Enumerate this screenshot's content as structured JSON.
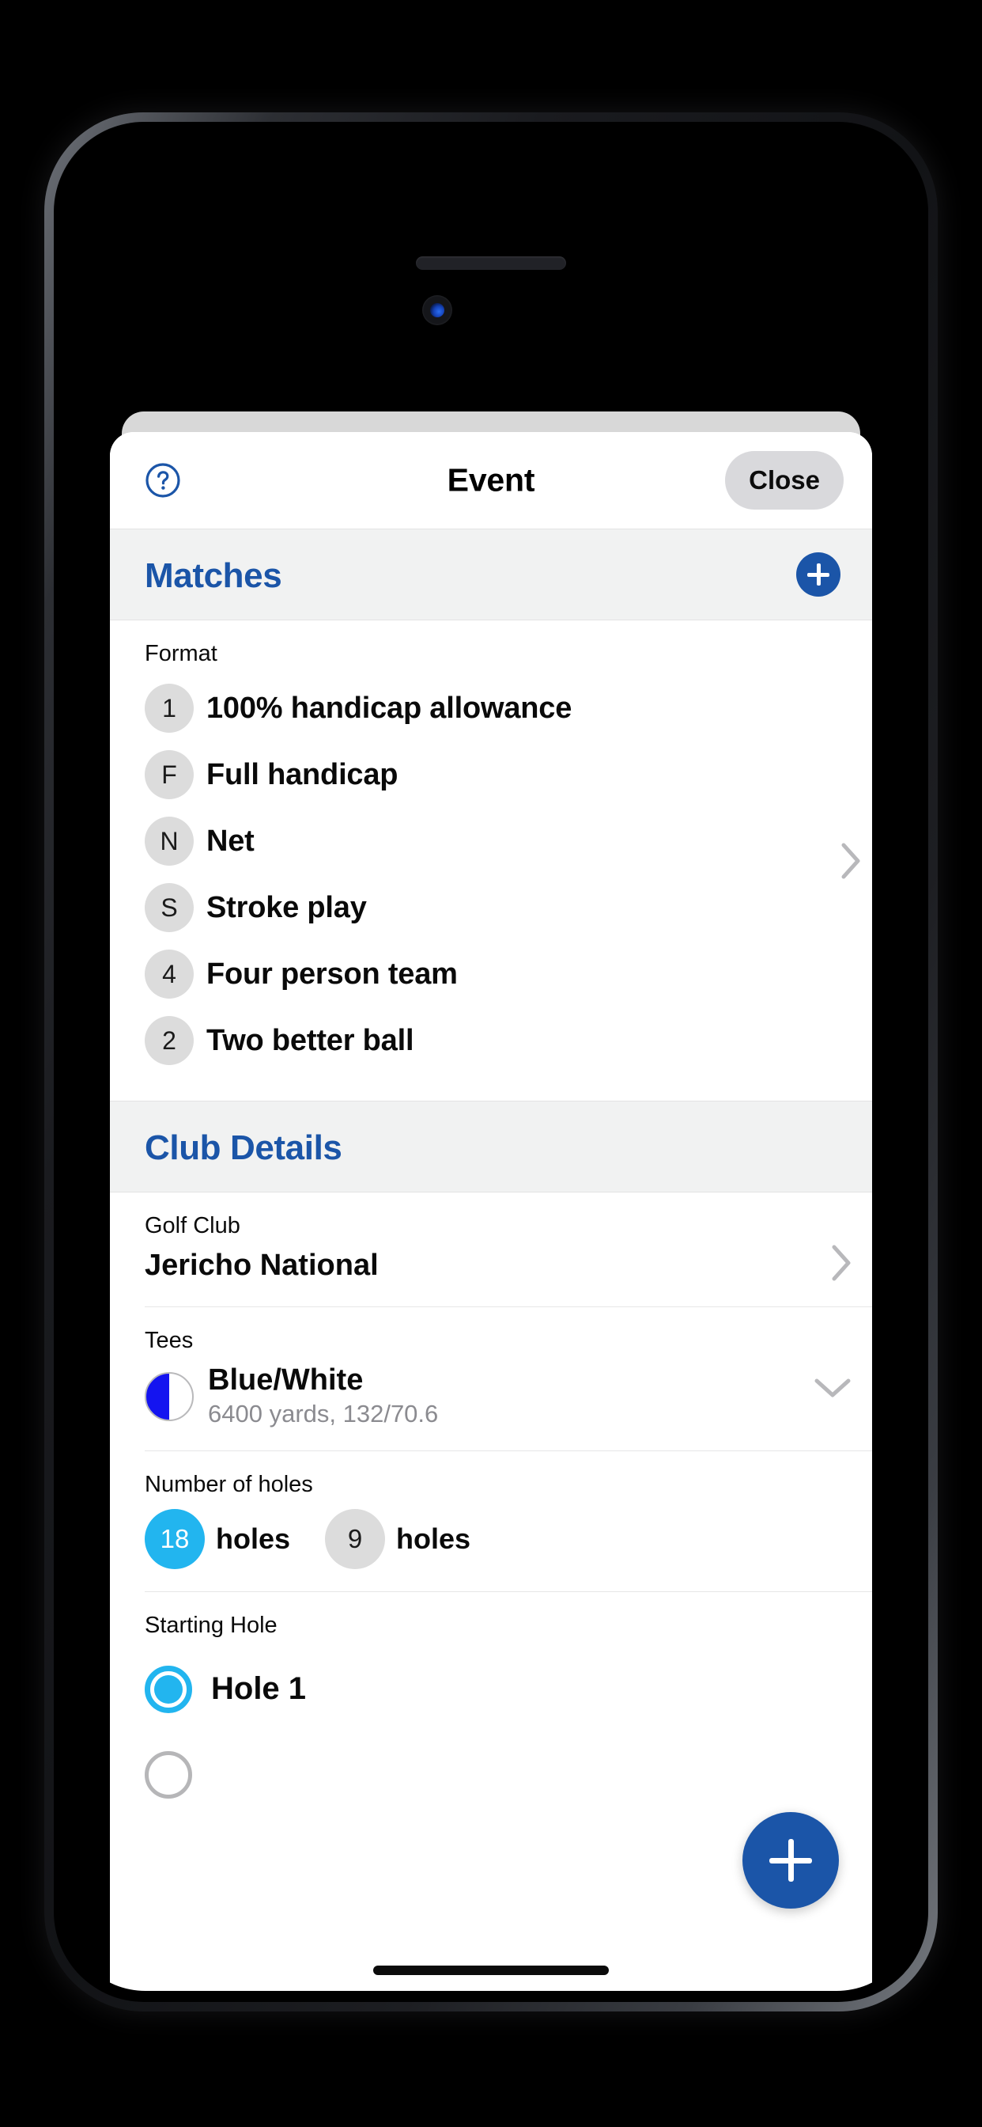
{
  "header": {
    "help_icon": "help-circle-icon",
    "title": "Event",
    "close_label": "Close"
  },
  "matches_section": {
    "title": "Matches",
    "add_icon": "plus-icon",
    "format_label": "Format",
    "chevron_icon": "chevron-right-icon",
    "format_items": [
      {
        "badge": "1",
        "label": "100% handicap allowance"
      },
      {
        "badge": "F",
        "label": "Full handicap"
      },
      {
        "badge": "N",
        "label": "Net"
      },
      {
        "badge": "S",
        "label": "Stroke play"
      },
      {
        "badge": "4",
        "label": "Four person team"
      },
      {
        "badge": "2",
        "label": "Two better ball"
      }
    ]
  },
  "club_details": {
    "title": "Club Details",
    "golf_club": {
      "label": "Golf Club",
      "value": "Jericho National",
      "chevron_icon": "chevron-right-icon"
    },
    "tees": {
      "label": "Tees",
      "marker_icon": "tee-marker-half-blue-white-icon",
      "name": "Blue/White",
      "details": "6400 yards, 132/70.6",
      "chevron_icon": "chevron-down-icon"
    },
    "holes": {
      "label": "Number of holes",
      "options": [
        {
          "count": "18",
          "unit": "holes",
          "selected": true
        },
        {
          "count": "9",
          "unit": "holes",
          "selected": false
        }
      ]
    },
    "starting_hole": {
      "label": "Starting Hole",
      "options": [
        {
          "label": "Hole 1",
          "selected": true
        },
        {
          "label": "",
          "selected": false
        }
      ]
    }
  },
  "fab": {
    "icon": "plus-icon"
  },
  "colors": {
    "accent_blue": "#1b55a8",
    "selected_cyan": "#22b5ef",
    "badge_gray": "#dcdcdc",
    "section_band": "#f1f2f2",
    "tee_blue": "#1414f0"
  }
}
